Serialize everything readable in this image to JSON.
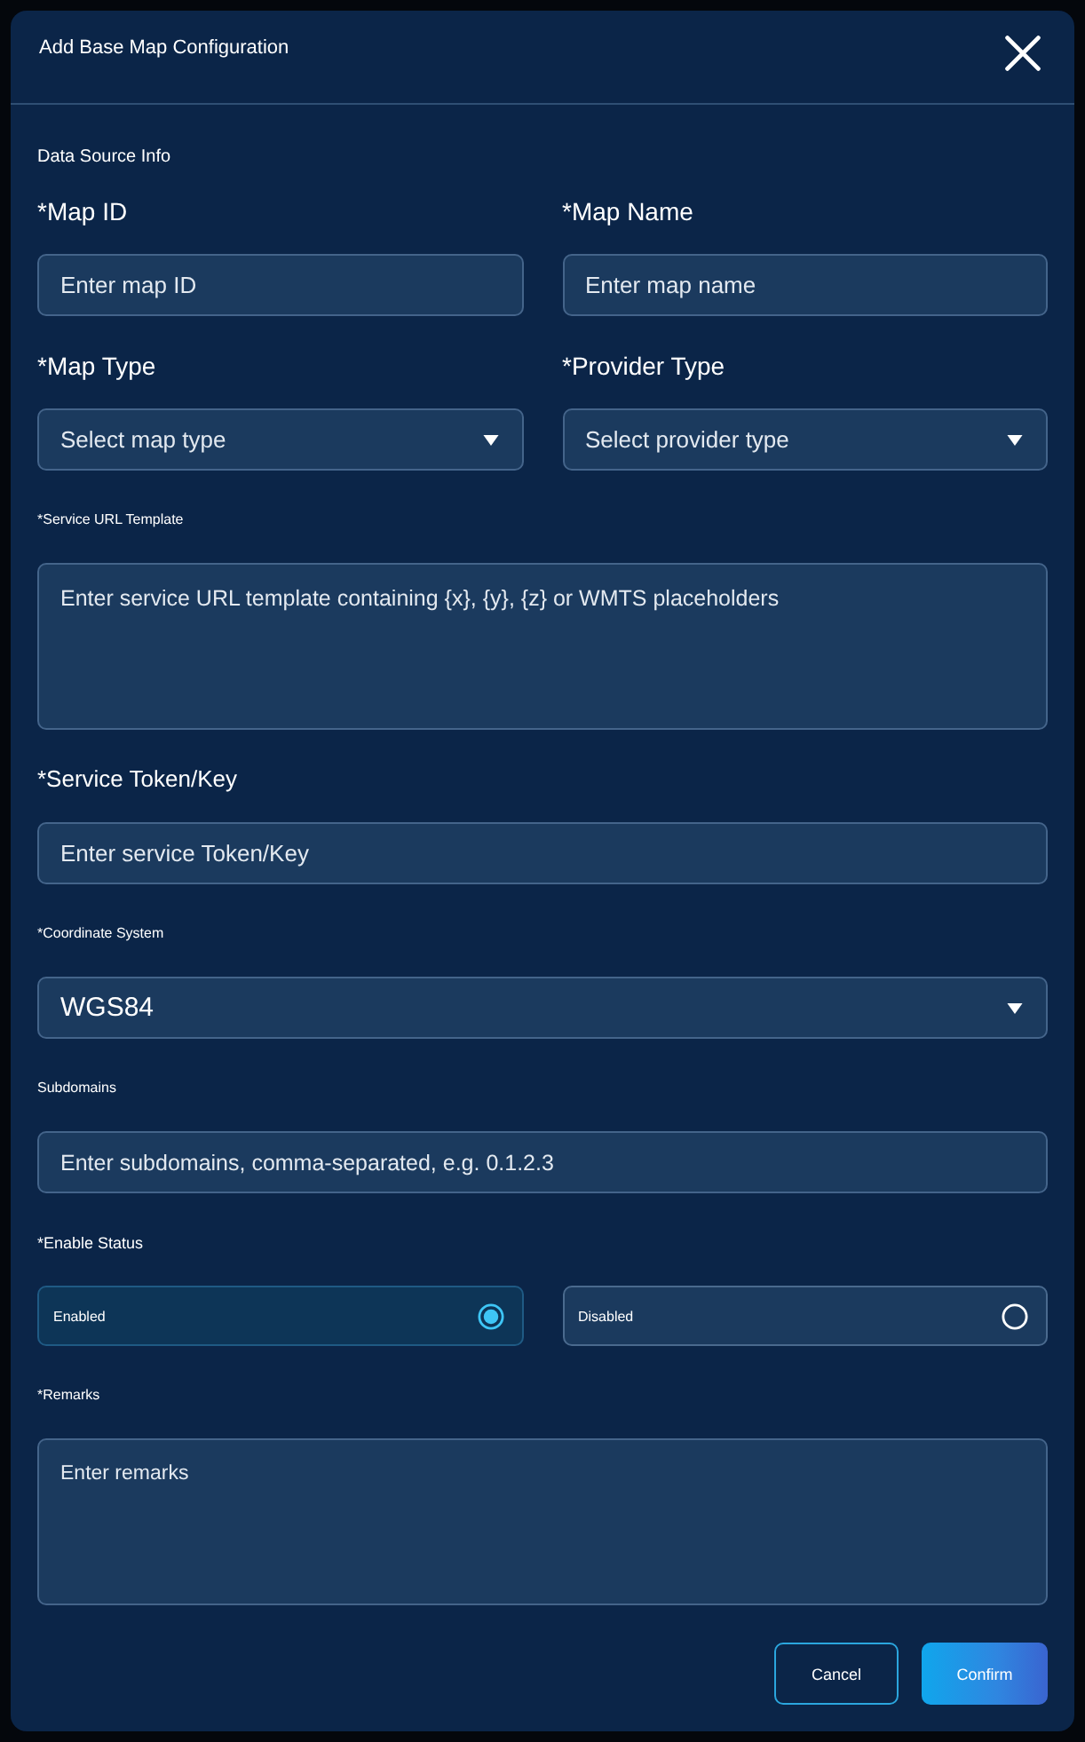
{
  "dialog": {
    "title": "Add Base Map Configuration"
  },
  "section_title": "Data Source Info",
  "rows": [
    {
      "fields": [
        {
          "kind": "input",
          "label": "*Map ID",
          "placeholder": "Enter map ID"
        },
        {
          "kind": "input",
          "label": "*Map Name",
          "placeholder": "Enter map name"
        }
      ]
    },
    {
      "fields": [
        {
          "kind": "select",
          "label": "*Map Type",
          "placeholder": "Select map type"
        },
        {
          "kind": "select",
          "label": "*Provider Type",
          "placeholder": "Select provider type"
        }
      ]
    },
    {
      "fields": [
        {
          "kind": "textarea",
          "label": "*Service URL Template",
          "placeholder": "Enter service URL template containing {x}, {y}, {z} or WMTS placeholders"
        }
      ]
    },
    {
      "fields": [
        {
          "kind": "input",
          "label": "*Service Token/Key",
          "placeholder": "Enter service Token/Key"
        }
      ]
    },
    {
      "fields": [
        {
          "kind": "select",
          "label": "*Coordinate System",
          "value": "WGS84"
        }
      ]
    },
    {
      "fields": [
        {
          "kind": "input",
          "label": "Subdomains",
          "placeholder": "Enter subdomains, comma-separated, e.g. 0.1.2.3"
        }
      ]
    },
    {
      "fields": [
        {
          "kind": "radio",
          "label": "*Enable Status",
          "options": [
            {
              "label": "Enabled",
              "selected": true
            },
            {
              "label": "Disabled",
              "selected": false
            }
          ]
        }
      ]
    },
    {
      "fields": [
        {
          "kind": "textarea",
          "label": "*Remarks",
          "placeholder": "Enter remarks"
        }
      ]
    }
  ],
  "buttons": [
    {
      "kind": "outline",
      "label": "Cancel"
    },
    {
      "kind": "filled",
      "label": "Confirm"
    }
  ]
}
